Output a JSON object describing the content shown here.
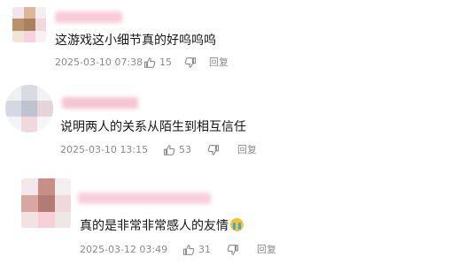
{
  "comments": [
    {
      "text": "这游戏这小细节真的好呜呜呜",
      "date": "2025-03-10 07:38",
      "likes": "15",
      "reply": "回复",
      "emoji": null
    },
    {
      "text": "说明两人的关系从陌生到相互信任",
      "date": "2025-03-10 13:15",
      "likes": "53",
      "reply": "回复",
      "emoji": null
    },
    {
      "text": "真的是非常非常感人的友情",
      "date": "2025-03-12 03:49",
      "likes": "31",
      "reply": "回复",
      "emoji": "loudly-crying-face"
    }
  ],
  "icons": {
    "like": "thumbs-up-icon",
    "dislike": "thumbs-down-icon"
  },
  "colors": {
    "meta_text": "#8a8a8a",
    "name_blur": "#f6c9d6"
  }
}
